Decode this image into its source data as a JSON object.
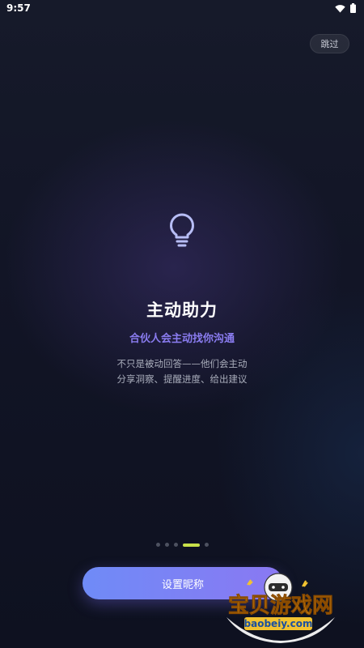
{
  "status_bar": {
    "time": "9:57",
    "icons": [
      "wifi-icon",
      "battery-icon"
    ]
  },
  "skip_label": "跳过",
  "onboarding": {
    "icon": "lightbulb-icon",
    "title": "主动助力",
    "subtitle": "合伙人会主动找你沟通",
    "description_line1": "不只是被动回答——他们会主动",
    "description_line2": "分享洞察、提醒进度、给出建议"
  },
  "pagination": {
    "total": 5,
    "current": 4
  },
  "cta_label": "设置昵称",
  "watermark": {
    "brand_text": "宝贝游戏网",
    "domain": "baobeiy.com"
  },
  "colors": {
    "accent_purple": "#8a7cf0",
    "cta_gradient_start": "#6f8bf7",
    "cta_gradient_end": "#8a78f2",
    "active_dot": "#c8e04a",
    "icon_stroke": "#b7bdf5"
  }
}
